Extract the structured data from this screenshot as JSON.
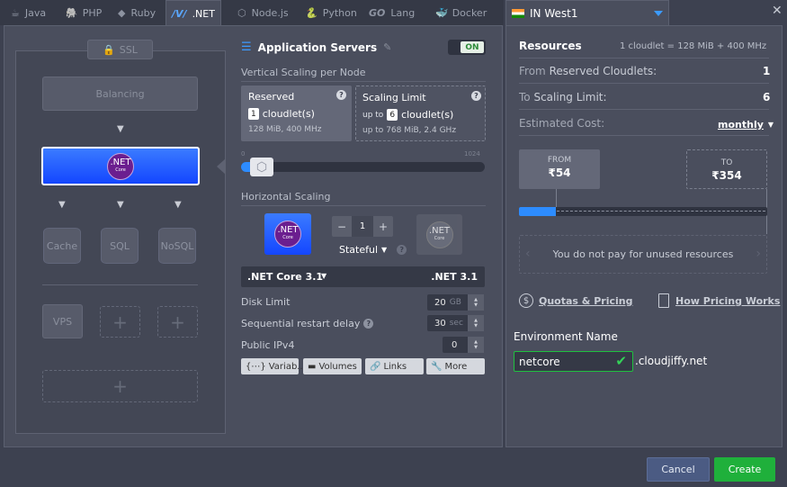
{
  "tabs": [
    {
      "label": "Java",
      "icon": "java-icon"
    },
    {
      "label": "PHP",
      "icon": "php-icon"
    },
    {
      "label": "Ruby",
      "icon": "ruby-icon"
    },
    {
      "label": ".NET",
      "icon": "dotnet-icon"
    },
    {
      "label": "Node.js",
      "icon": "nodejs-icon"
    },
    {
      "label": "Python",
      "icon": "python-icon"
    },
    {
      "label": "Lang",
      "icon": "go-icon"
    },
    {
      "label": "Docker",
      "icon": "docker-icon"
    }
  ],
  "go_text": "GO",
  "region": {
    "label": "IN West1"
  },
  "topology": {
    "ssl": "SSL",
    "balancing": "Balancing",
    "net_logo": ".NET",
    "net_logo_sub": "Core",
    "cache": "Cache",
    "sql": "SQL",
    "nosql": "NoSQL",
    "vps": "VPS",
    "plus": "+"
  },
  "config": {
    "title": "Application Servers",
    "toggle": "ON",
    "vertical_title": "Vertical Scaling per Node",
    "reserved": {
      "label": "Reserved",
      "value": "1",
      "unit": "cloudlet(s)",
      "info": "128 MiB, 400 MHz"
    },
    "limit": {
      "label": "Scaling Limit",
      "prefix": "up to",
      "value": "6",
      "unit": "cloudlet(s)",
      "info_prefix": "up to",
      "info": "768 MiB, 2.4 GHz"
    },
    "slider_min": "0",
    "slider_max": "1024",
    "horizontal_title": "Horizontal Scaling",
    "nodes_count": "1",
    "minus": "−",
    "plus": "+",
    "stateful": "Stateful",
    "engine_select": ".NET Core 3.1",
    "engine_value": ".NET 3.1",
    "disk_label": "Disk Limit",
    "disk_value": "20",
    "disk_unit": "GB",
    "restart_label": "Sequential restart delay",
    "restart_value": "30",
    "restart_unit": "sec",
    "ipv4_label": "Public IPv4",
    "ipv4_value": "0",
    "btn_variables": "Variab...",
    "btn_volumes": "Volumes",
    "btn_links": "Links",
    "btn_more": "More"
  },
  "resources": {
    "title": "Resources",
    "cloudlet_info": "1 cloudlet = 128 MiB + 400 MHz",
    "from_prefix": "From",
    "from_label": "Reserved Cloudlets:",
    "from_value": "1",
    "to_prefix": "To",
    "to_label": "Scaling Limit:",
    "to_value": "6",
    "cost_label": "Estimated Cost:",
    "cost_period": "monthly",
    "price_from_label": "FROM",
    "price_from": "₹54",
    "price_to_label": "TO",
    "price_to": "₹354",
    "range_fraction": 0.15,
    "unused_msg": "You do not pay for unused resources",
    "quotas_link": "Quotas & Pricing",
    "pricing_link": "How Pricing Works"
  },
  "environment": {
    "label": "Environment Name",
    "name": "netcore",
    "domain": ".cloudjiffy.net"
  },
  "footer": {
    "cancel": "Cancel",
    "create": "Create"
  },
  "colors": {
    "accent": "#3c9bff",
    "create": "#1fb03b",
    "cancel": "#4b5b83"
  }
}
